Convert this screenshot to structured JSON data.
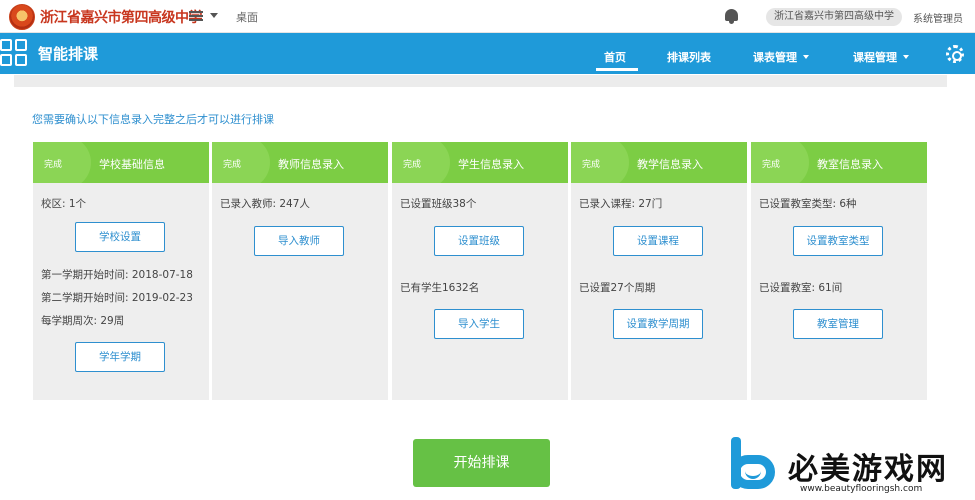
{
  "topbar": {
    "school_name": "浙江省嘉兴市第四高级中学",
    "desktop_label": "桌面",
    "school_pill": "浙江省嘉兴市第四高级中学",
    "user_label": "系统管理员"
  },
  "navbar": {
    "app_title": "智能排课",
    "items": [
      {
        "label": "首页",
        "active": true
      },
      {
        "label": "排课列表"
      },
      {
        "label": "课表管理"
      },
      {
        "label": "课程管理"
      }
    ],
    "colors": {
      "nav": "#1f9ad9",
      "card_head": "#7ccd44",
      "start_button": "#66c145"
    }
  },
  "notice": "您需要确认以下信息录入完整之后才可以进行排课",
  "cards": [
    {
      "status": "完成",
      "title": "学校基础信息",
      "texts": [
        "校区: 1个",
        "第一学期开始时间: 2018-07-18",
        "第二学期开始时间: 2019-02-23",
        "每学期周次: 29周"
      ],
      "buttons": [
        "学校设置",
        "学年学期"
      ]
    },
    {
      "status": "完成",
      "title": "教师信息录入",
      "texts": [
        "已录入教师: 247人"
      ],
      "buttons": [
        "导入教师"
      ]
    },
    {
      "status": "完成",
      "title": "学生信息录入",
      "texts": [
        "已设置班级38个",
        "已有学生1632名"
      ],
      "buttons": [
        "设置班级",
        "导入学生"
      ]
    },
    {
      "status": "完成",
      "title": "教学信息录入",
      "texts": [
        "已录入课程: 27门",
        "已设置27个周期"
      ],
      "buttons": [
        "设置课程",
        "设置教学周期"
      ]
    },
    {
      "status": "完成",
      "title": "教室信息录入",
      "texts": [
        "已设置教室类型: 6种",
        "已设置教室: 61间"
      ],
      "buttons": [
        "设置教室类型",
        "教室管理"
      ]
    }
  ],
  "start_button": "开始排课",
  "watermark": {
    "text": "必美游戏网",
    "url": "www.beautyflooringsh.com"
  }
}
